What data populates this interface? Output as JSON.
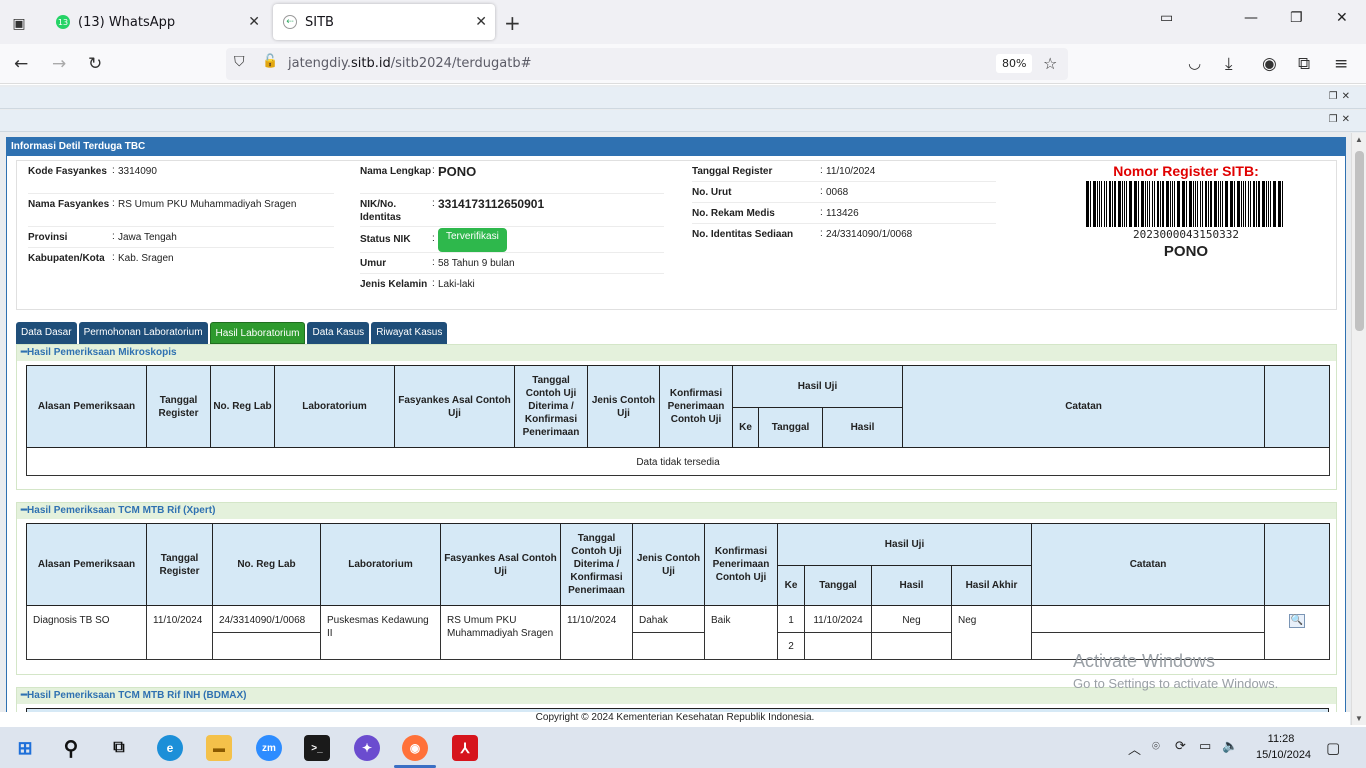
{
  "browser": {
    "tabs": [
      {
        "label": "(13) WhatsApp",
        "badge": "13",
        "active": false
      },
      {
        "label": "SITB",
        "active": true
      }
    ],
    "url_prefix": "jatengdiy.",
    "url_domain": "sitb.id",
    "url_path": "/sitb2024/terdugatb#",
    "zoom": "80%"
  },
  "panel": {
    "title": "Informasi Detil Terduga TBC"
  },
  "info": {
    "col1": [
      {
        "label": "Kode Fasyankes",
        "value": "3314090"
      },
      {
        "label": "Nama Fasyankes",
        "value": "RS Umum PKU Muhammadiyah Sragen"
      },
      {
        "label": "Provinsi",
        "value": "Jawa Tengah"
      },
      {
        "label": "Kabupaten/Kota",
        "value": "Kab. Sragen"
      }
    ],
    "col2": [
      {
        "label": "Nama Lengkap",
        "value": "PONO"
      },
      {
        "label": "NIK/No. Identitas",
        "value": "3314173112650901"
      },
      {
        "label": "Status NIK",
        "value": "Terverifikasi"
      },
      {
        "label": "Umur",
        "value": "58 Tahun 9 bulan"
      },
      {
        "label": "Jenis Kelamin",
        "value": "Laki-laki"
      }
    ],
    "col3": [
      {
        "label": "Tanggal Register",
        "value": "11/10/2024"
      },
      {
        "label": "No. Urut",
        "value": "0068"
      },
      {
        "label": "No. Rekam Medis",
        "value": "113426"
      },
      {
        "label": "No. Identitas Sediaan",
        "value": "24/3314090/1/0068"
      }
    ],
    "register_title": "Nomor Register SITB:",
    "register_number": "2023000043150332",
    "register_name": "PONO"
  },
  "tabs": [
    "Data Dasar",
    "Permohonan Laboratorium",
    "Hasil Laboratorium",
    "Data Kasus",
    "Riwayat Kasus"
  ],
  "mikroskopis": {
    "title": "Hasil Pemeriksaan Mikroskopis",
    "headers": [
      "Alasan Pemeriksaan",
      "Tanggal Register",
      "No. Reg Lab",
      "Laboratorium",
      "Fasyankes Asal Contoh Uji",
      "Tanggal Contoh Uji Diterima / Konfirmasi Penerimaan",
      "Jenis Contoh Uji",
      "Konfirmasi Penerimaan Contoh Uji",
      "Hasil Uji",
      "Catatan"
    ],
    "sub_headers": [
      "Ke",
      "Tanggal",
      "Hasil"
    ],
    "empty": "Data tidak tersedia"
  },
  "tcm": {
    "title": "Hasil Pemeriksaan TCM MTB Rif (Xpert)",
    "headers": [
      "Alasan Pemeriksaan",
      "Tanggal Register",
      "No. Reg Lab",
      "Laboratorium",
      "Fasyankes Asal Contoh Uji",
      "Tanggal Contoh Uji Diterima / Konfirmasi Penerimaan",
      "Jenis Contoh Uji",
      "Konfirmasi Penerimaan Contoh Uji",
      "Hasil Uji",
      "Catatan"
    ],
    "sub_headers": [
      "Ke",
      "Tanggal",
      "Hasil",
      "Hasil Akhir"
    ],
    "row": {
      "alasan": "Diagnosis TB SO",
      "tanggal_register": "11/10/2024",
      "no_reg_lab": "24/3314090/1/0068",
      "laboratorium": "Puskesmas Kedawung II",
      "fasyankes": "RS Umum PKU Muhammadiyah Sragen",
      "tanggal_diterima": "11/10/2024",
      "jenis": "Dahak",
      "konfirmasi": "Baik",
      "ke1": "1",
      "tanggal1": "11/10/2024",
      "hasil1": "Neg",
      "hasil_akhir": "Neg",
      "ke2": "2"
    }
  },
  "bdmax": {
    "title": "Hasil Pemeriksaan TCM MTB Rif INH (BDMAX)"
  },
  "footer": {
    "copyright": "Copyright © 2024 Kementerian Kesehatan Republik Indonesia."
  },
  "watermark": {
    "line1": "Activate Windows",
    "line2": "Go to Settings to activate Windows."
  },
  "taskbar": {
    "time": "11:28",
    "date": "15/10/2024"
  }
}
